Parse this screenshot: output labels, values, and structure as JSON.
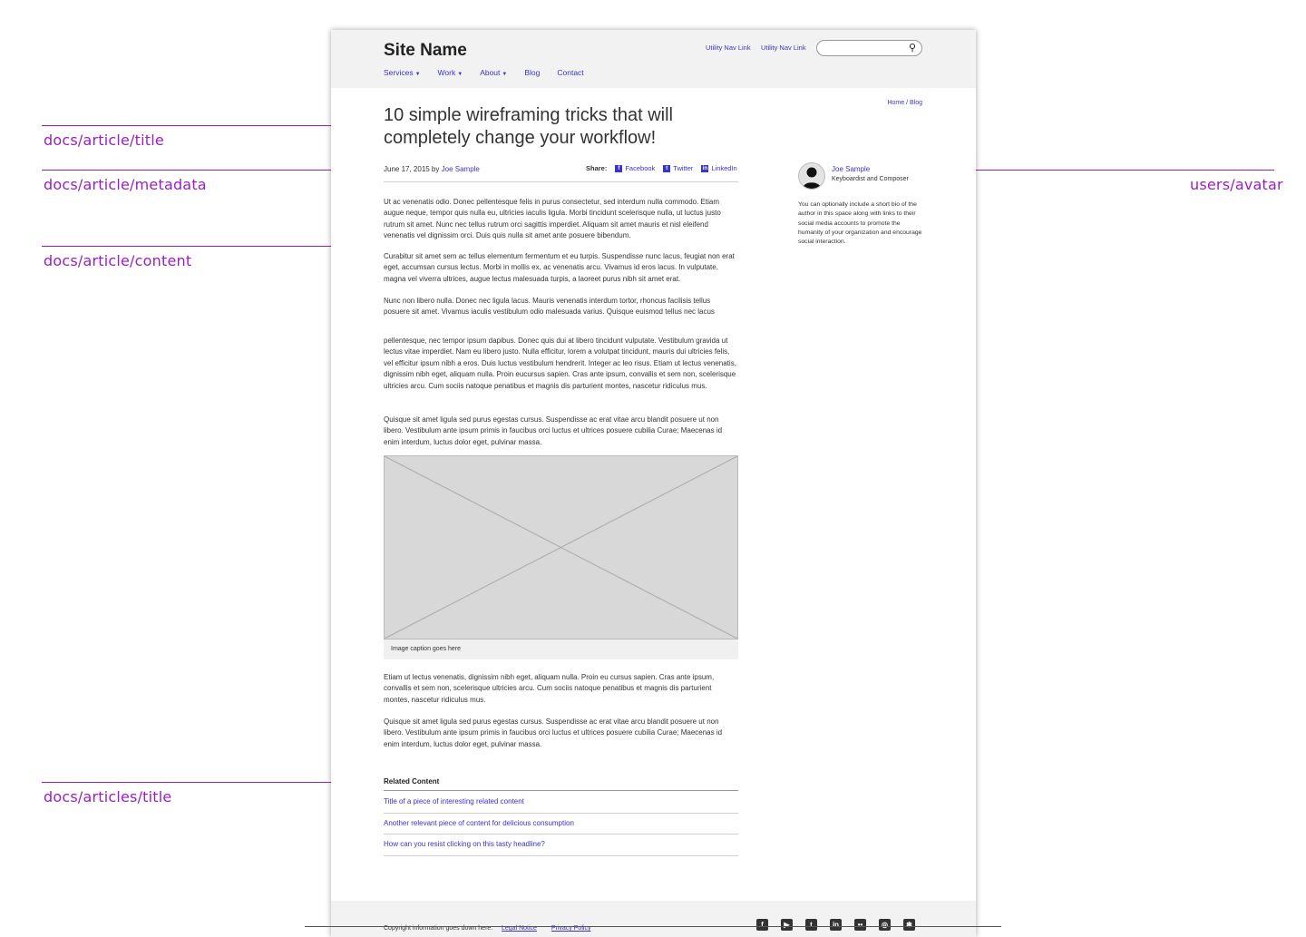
{
  "annotations": {
    "title": "docs/article/title",
    "metadata": "docs/article/metadata",
    "content": "docs/article/content",
    "related": "docs/articles/title",
    "avatar": "users/avatar"
  },
  "header": {
    "site_name": "Site Name",
    "utility_links": [
      "Utility Nav Link",
      "Utility Nav Link"
    ],
    "search_placeholder": "",
    "nav": [
      {
        "label": "Services",
        "dropdown": true
      },
      {
        "label": "Work",
        "dropdown": true
      },
      {
        "label": "About",
        "dropdown": true
      },
      {
        "label": "Blog",
        "dropdown": false
      },
      {
        "label": "Contact",
        "dropdown": false
      }
    ]
  },
  "breadcrumb": "Home / Blog",
  "article": {
    "title": "10 simple wireframing tricks that will completely change your workflow!",
    "date": "June 17, 2015 by",
    "author": "Joe Sample",
    "share_label": "Share:",
    "share": [
      "Facebook",
      "Twitter",
      "LinkedIn"
    ],
    "paragraphs": [
      "Ut ac venenatis odio. Donec pellentesque felis in purus consectetur, sed interdum nulla commodo. Etiam augue neque, tempor quis nulla eu, ultricies iaculis ligula. Morbi tincidunt scelerisque nulla, ut luctus justo rutrum sit amet. Nunc nec tellus rutrum orci sagittis imperdiet. Aliquam sit amet mauris et nisl eleifend venenatis vel dignissim orci. Duis quis nulla sit amet ante posuere bibendum.",
      "Curabitur sit amet sem ac tellus elementum fermentum et eu turpis. Suspendisse nunc lacus, feugiat non erat eget, accumsan cursus lectus. Morbi in mollis ex, ac venenatis arcu. Vivamus id eros lacus. In vulputate, magna vel viverra ultrices, augue lectus malesuada turpis, a laoreet purus nibh sit amet erat.",
      "Nunc non libero nulla. Donec nec ligula lacus. Mauris venenatis interdum tortor, rhoncus facilisis tellus posuere sit amet. Vivamus iaculis vestibulum odio malesuada varius. Quisque euismod tellus nec lacus",
      "pellentesque, nec tempor ipsum dapibus. Donec quis dui at libero tincidunt vulputate. Vestibulum gravida ut lectus vitae imperdiet. Nam eu libero justo. Nulla efficitur, lorem a volutpat tincidunt, mauris dui ultricies felis, vel efficitur ipsum nibh a eros. Duis luctus vestibulum hendrerit. Integer ac leo risus. Etiam ut lectus venenatis, dignissim nibh eget, aliquam nulla. Proin eucursus sapien. Cras ante ipsum, convallis et sem non, scelerisque ultricies arcu. Cum sociis natoque penatibus et magnis dis parturient montes, nascetur ridiculus mus.",
      "Quisque sit amet ligula sed purus egestas cursus. Suspendisse ac erat vitae arcu blandit posuere ut non libero. Vestibulum ante ipsum primis in faucibus orci luctus et ultrices posuere cubilia Curae; Maecenas id enim interdum, luctus dolor eget, pulvinar massa.",
      "Etiam ut lectus venenatis, dignissim nibh eget, aliquam nulla. Proin eu cursus sapien. Cras ante ipsum, convallis et sem non, scelerisque ultricies arcu. Cum sociis natoque penatibus et magnis dis parturient montes, nascetur ridiculus mus.",
      "Quisque sit amet ligula sed purus egestas cursus. Suspendisse ac erat vitae arcu blandit posuere ut non libero. Vestibulum ante ipsum primis in faucibus orci luctus et ultrices posuere cubilia Curae; Maecenas id enim interdum, luctus dolor eget, pulvinar massa."
    ],
    "image_caption": "Image caption goes here"
  },
  "related": {
    "heading": "Related Content",
    "links": [
      "Title of a piece of interesting related content",
      "Another relevant piece of content for delicious consumption",
      "How can you resist clicking on this tasty headline?"
    ]
  },
  "author_card": {
    "name": "Joe Sample",
    "role": "Keyboardist and Composer",
    "bio": "You can optionally include a short bio of the author in this space along with links to their social media accounts to promote the humanity of your organization and encourage social interaction."
  },
  "footer": {
    "copyright": "Copyright information goes down here.",
    "links": [
      "Legal Notice",
      "Privacy Policy"
    ],
    "social_icons": [
      "facebook-icon",
      "youtube-icon",
      "twitter-icon",
      "linkedin-icon",
      "flickr-icon",
      "instagram-icon",
      "yelp-icon"
    ]
  },
  "colors": {
    "annotation": "#9b1fc0",
    "link": "#3a34c8",
    "header_bg": "#f2f2f2"
  }
}
